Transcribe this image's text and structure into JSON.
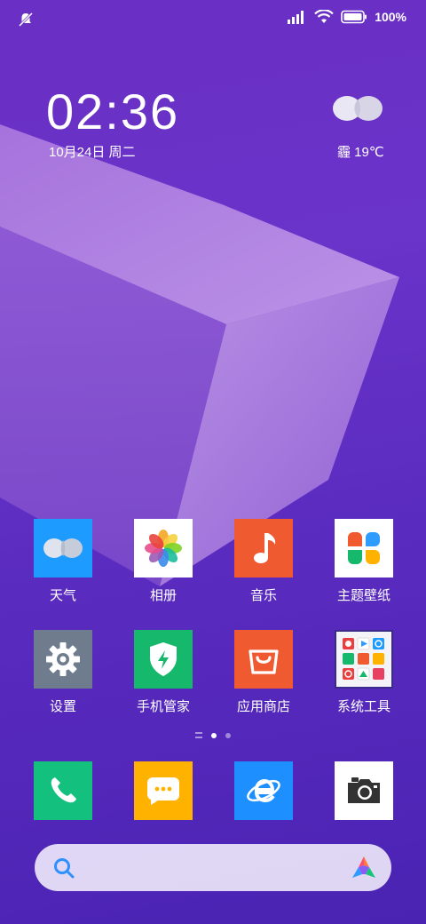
{
  "status_bar": {
    "battery_text": "100%",
    "icons": [
      "notification-muted-icon",
      "signal-icon",
      "wifi-icon",
      "battery-icon"
    ]
  },
  "clock_widget": {
    "time": "02:36",
    "date": "10月24日 周二",
    "weather": "霾 19℃",
    "weather_icon": "weather-haze-icon"
  },
  "apps_row1": [
    {
      "label": "天气",
      "icon": "weather-app-icon",
      "color": "#1e9bff"
    },
    {
      "label": "相册",
      "icon": "gallery-app-icon",
      "color": "#ffffff"
    },
    {
      "label": "音乐",
      "icon": "music-app-icon",
      "color": "#f05a30"
    },
    {
      "label": "主题壁纸",
      "icon": "themes-app-icon",
      "color": "#ffffff"
    }
  ],
  "apps_row2": [
    {
      "label": "设置",
      "icon": "settings-app-icon",
      "color": "#6f7c8e"
    },
    {
      "label": "手机管家",
      "icon": "security-app-icon",
      "color": "#16b86c"
    },
    {
      "label": "应用商店",
      "icon": "app-store-icon",
      "color": "#f05a30"
    },
    {
      "label": "系统工具",
      "icon": "system-tools-folder-icon",
      "color": "#ffffff"
    }
  ],
  "page_indicator": {
    "pages": 2,
    "active": 1
  },
  "dock": [
    {
      "icon": "phone-app-icon",
      "color": "#13c07e"
    },
    {
      "icon": "messages-app-icon",
      "color": "#ffb300"
    },
    {
      "icon": "browser-app-icon",
      "color": "#1e8fff"
    },
    {
      "icon": "camera-app-icon",
      "color": "#ffffff"
    }
  ],
  "search_bar": {
    "icon": "search-icon",
    "logo": "assistant-logo-icon"
  }
}
